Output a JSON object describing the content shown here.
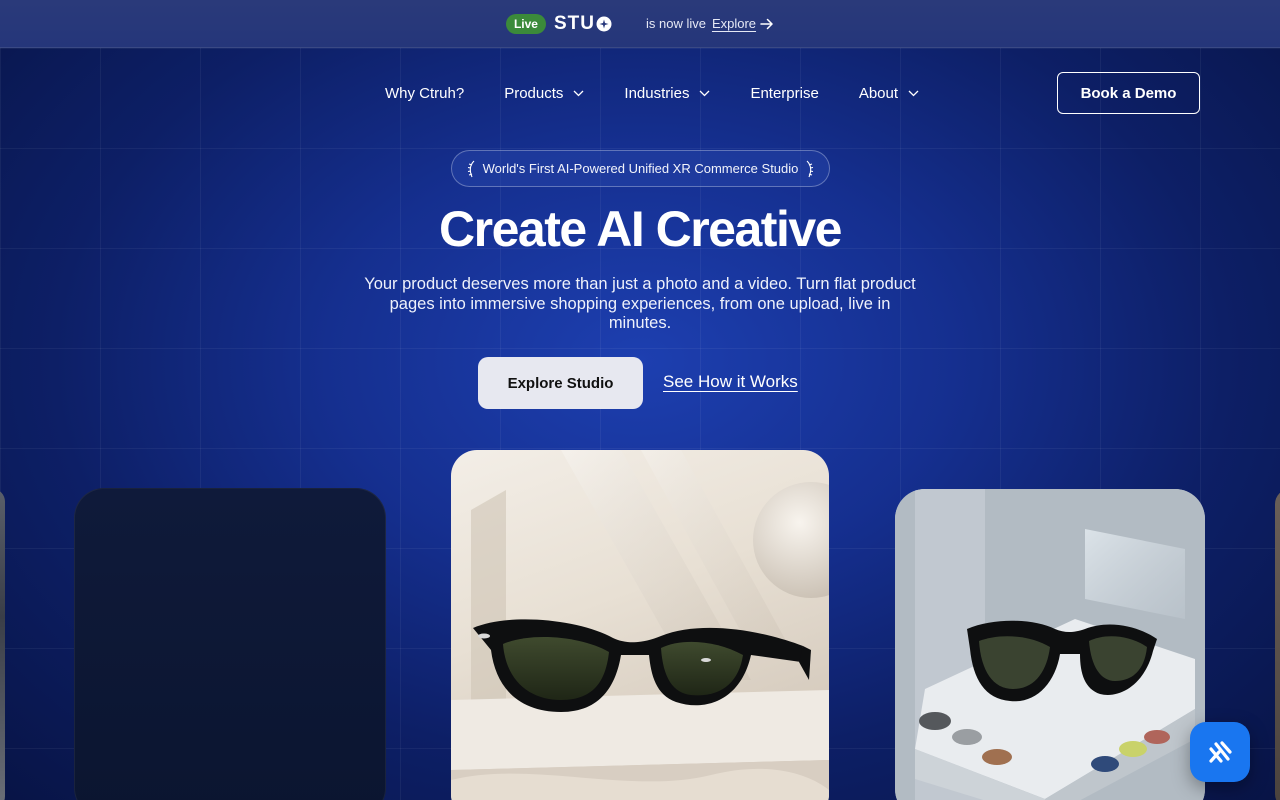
{
  "announcement": {
    "badge": "Live",
    "brand": "STU",
    "text": "is now live",
    "link": "Explore",
    "icons": {
      "arrow": "arrow-right-icon"
    }
  },
  "nav": {
    "items": [
      {
        "label": "Why Ctruh?",
        "has_dropdown": false
      },
      {
        "label": "Products",
        "has_dropdown": true
      },
      {
        "label": "Industries",
        "has_dropdown": true
      },
      {
        "label": "Enterprise",
        "has_dropdown": false
      },
      {
        "label": "About",
        "has_dropdown": true
      }
    ],
    "cta": "Book a Demo"
  },
  "hero": {
    "pill": "World's First AI-Powered Unified XR Commerce Studio",
    "title": "Create AI Creative",
    "subtitle": "Your product deserves more than just a photo and a video. Turn flat product pages into immersive shopping experiences, from one upload, live in minutes.",
    "primary_cta": "Explore Studio",
    "secondary_cta": "See How it Works"
  },
  "showcase": {
    "cards": [
      "partial-left",
      "dark-placeholder",
      "sunglasses-on-marble",
      "sunglasses-on-display",
      "partial-right"
    ]
  },
  "chat_widget": {
    "icon": "chat-logo-icon"
  },
  "colors": {
    "background": "#152f8f",
    "live_badge": "#3b8a3a",
    "primary_button": "#e7e8f0",
    "chat_button": "#1976f0"
  }
}
